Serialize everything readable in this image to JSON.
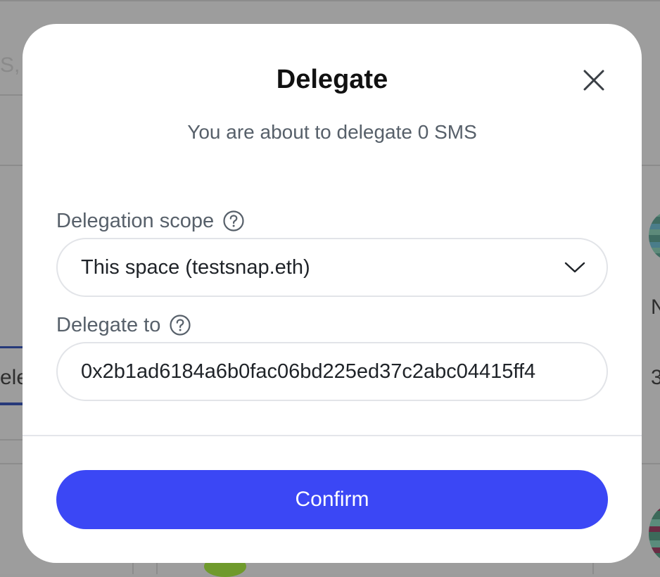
{
  "background": {
    "left_fragments": [
      "S,",
      "ele"
    ],
    "right_fragments": [
      "N",
      "3"
    ]
  },
  "modal": {
    "title": "Delegate",
    "subtitle": "You are about to delegate 0 SMS",
    "scope": {
      "label": "Delegation scope",
      "value": "This space (testsnap.eth)"
    },
    "delegate_to": {
      "label": "Delegate to",
      "value": "0x2b1ad6184a6b0fac06bd225ed37c2abc04415ff4"
    },
    "confirm_label": "Confirm"
  },
  "icons": {
    "close": "close-icon",
    "help": "question-circle-icon",
    "dropdown": "chevron-down-icon"
  },
  "colors": {
    "accent": "#3b47f5",
    "overlay": "#9d9d9d"
  }
}
